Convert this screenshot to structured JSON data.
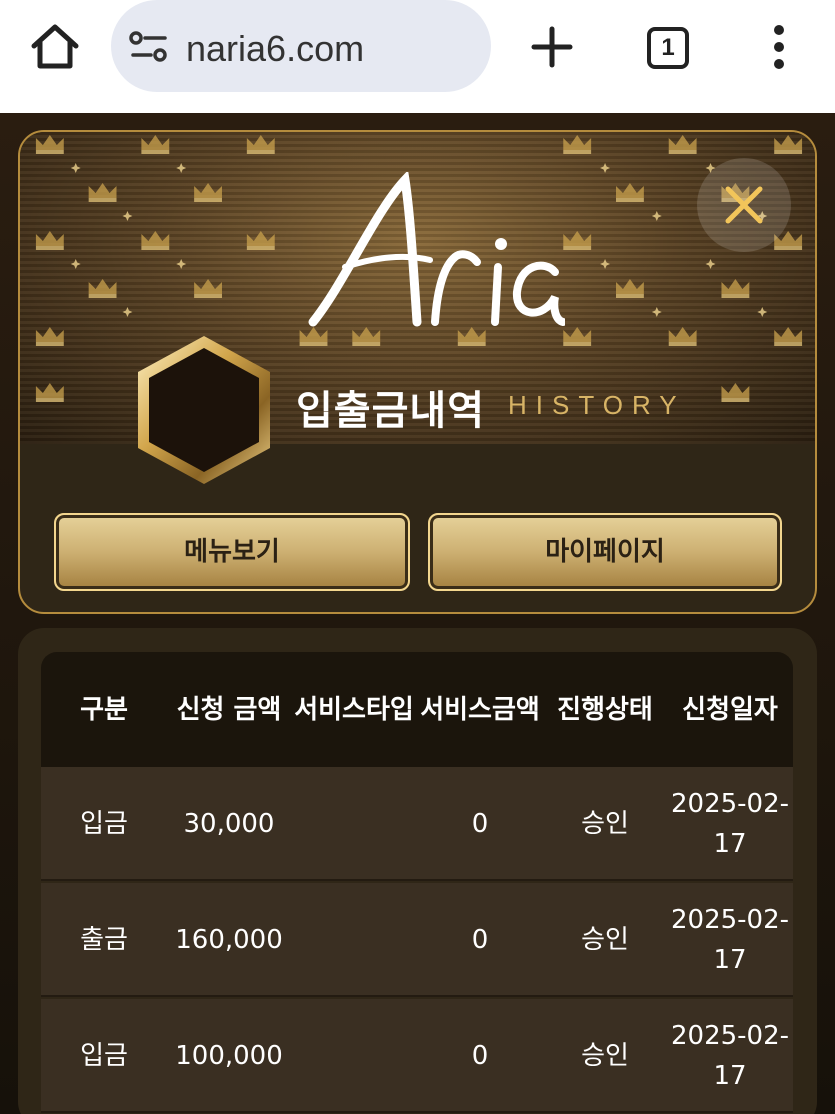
{
  "browser": {
    "url": "naria6.com",
    "tab_count": "1"
  },
  "header": {
    "logo_text": "Aria",
    "title": "입출금내역",
    "title_en": "HISTORY"
  },
  "buttons": {
    "menu": "메뉴보기",
    "mypage": "마이페이지"
  },
  "table": {
    "headers": [
      "구분",
      "신청 금액",
      "서비스타입",
      "서비스금액",
      "진행상태",
      "신청일자"
    ],
    "rows": [
      {
        "type": "입금",
        "amount": "30,000",
        "service_type": "",
        "service_amount": "0",
        "status": "승인",
        "date": "2025-02-17"
      },
      {
        "type": "출금",
        "amount": "160,000",
        "service_type": "",
        "service_amount": "0",
        "status": "승인",
        "date": "2025-02-17"
      },
      {
        "type": "입금",
        "amount": "100,000",
        "service_type": "",
        "service_amount": "0",
        "status": "승인",
        "date": "2025-02-17"
      }
    ]
  },
  "colors": {
    "gold": "#d8b466",
    "panel": "#2f2617",
    "row": "#3a2f22"
  },
  "icons": [
    "home-icon",
    "site-info-icon",
    "plus-icon",
    "kebab-menu-icon",
    "close-icon",
    "crown-icon",
    "hexagon-emblem"
  ]
}
